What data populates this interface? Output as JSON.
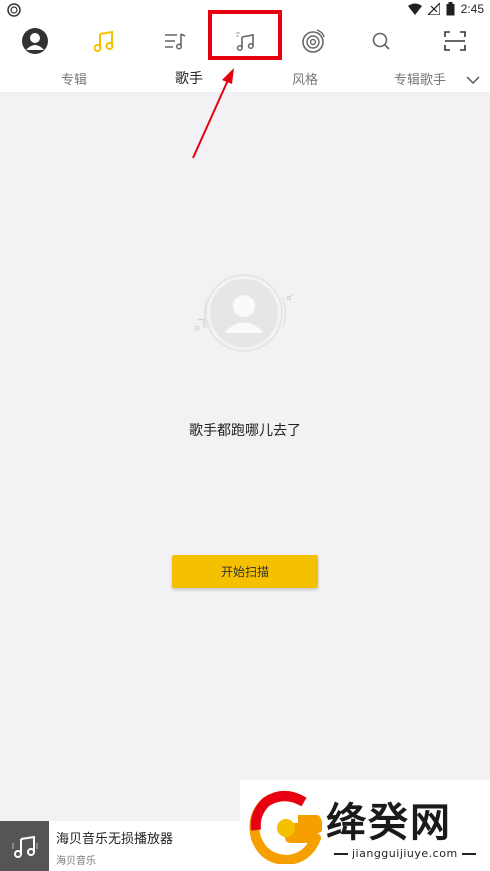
{
  "status_bar": {
    "time": "2:45"
  },
  "top_nav": {
    "icons": [
      "avatar-icon",
      "music-note-icon",
      "playlist-icon",
      "local-music-icon",
      "radio-disc-icon",
      "search-icon",
      "scan-icon"
    ],
    "active_color": "#f5c000",
    "highlight_color": "#e60012"
  },
  "tabs": {
    "items": [
      "专辑",
      "歌手",
      "风格",
      "专辑歌手"
    ],
    "active": "歌手"
  },
  "empty_state": {
    "message": "歌手都跑哪儿去了",
    "button_label": "开始扫描",
    "button_color": "#f5c000"
  },
  "mini_player": {
    "title": "海贝音乐无损播放器",
    "subtitle": "海贝音乐"
  },
  "watermark": {
    "text": "绛癸网",
    "domain": "jiangguijiuye.com"
  }
}
